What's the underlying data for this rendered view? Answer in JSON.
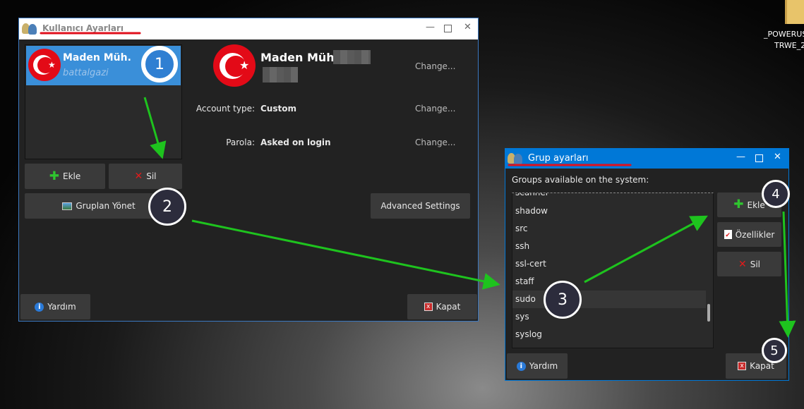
{
  "desktop": {
    "icon_label_line1": "_POWERUS",
    "icon_label_line2": "TRWE_2"
  },
  "user_window": {
    "title": "Kullanıcı Ayarları",
    "users": [
      {
        "name": "Maden Müh.",
        "login": "battalgazi",
        "selected": true
      }
    ],
    "add_label": "Ekle",
    "delete_label": "Sil",
    "manage_groups_label": "Gruplan Yönet",
    "profile_name": "Maden Müh.",
    "change_label": "Change...",
    "account_type_label": "Account type:",
    "account_type_value": "Custom",
    "password_label": "Parola:",
    "password_value": "Asked on login",
    "advanced_label": "Advanced Settings",
    "help_label": "Yardım",
    "close_label": "Kapat"
  },
  "group_window": {
    "title": "Grup ayarları",
    "groups_caption": "Groups available on the system:",
    "groups": [
      "scanner",
      "shadow",
      "src",
      "ssh",
      "ssl-cert",
      "staff",
      "sudo",
      "sys",
      "syslog"
    ],
    "selected_group": "sudo",
    "add_label": "Ekle",
    "properties_label": "Özellikler",
    "delete_label": "Sil",
    "help_label": "Yardım",
    "close_label": "Kapat"
  },
  "annotations": [
    "1",
    "2",
    "3",
    "4",
    "5"
  ],
  "colors": {
    "accent": "#0078d7",
    "selection": "#3a8fd9",
    "arrow": "#1ec31e",
    "underline": "#e0101c"
  }
}
